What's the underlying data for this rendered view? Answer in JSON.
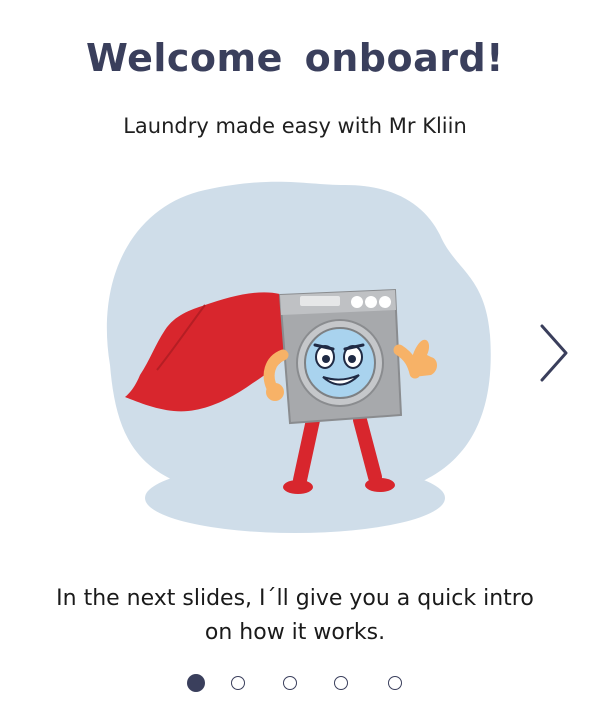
{
  "header": {
    "title": "Welcome onboard!",
    "subtitle": "Laundry made easy with Mr Kliin"
  },
  "illustration": {
    "icon": "superhero-washing-machine-icon"
  },
  "navigation": {
    "next_icon": "chevron-right-icon"
  },
  "body": {
    "description": "In the next slides, I´ll give you a quick intro on how it works."
  },
  "pagination": {
    "total": 5,
    "current": 1
  },
  "colors": {
    "accent": "#3a3f5c",
    "blob": "#cfdde9",
    "cape": "#d8262d",
    "machine": "#a7a9ac",
    "skin": "#f7b267"
  }
}
